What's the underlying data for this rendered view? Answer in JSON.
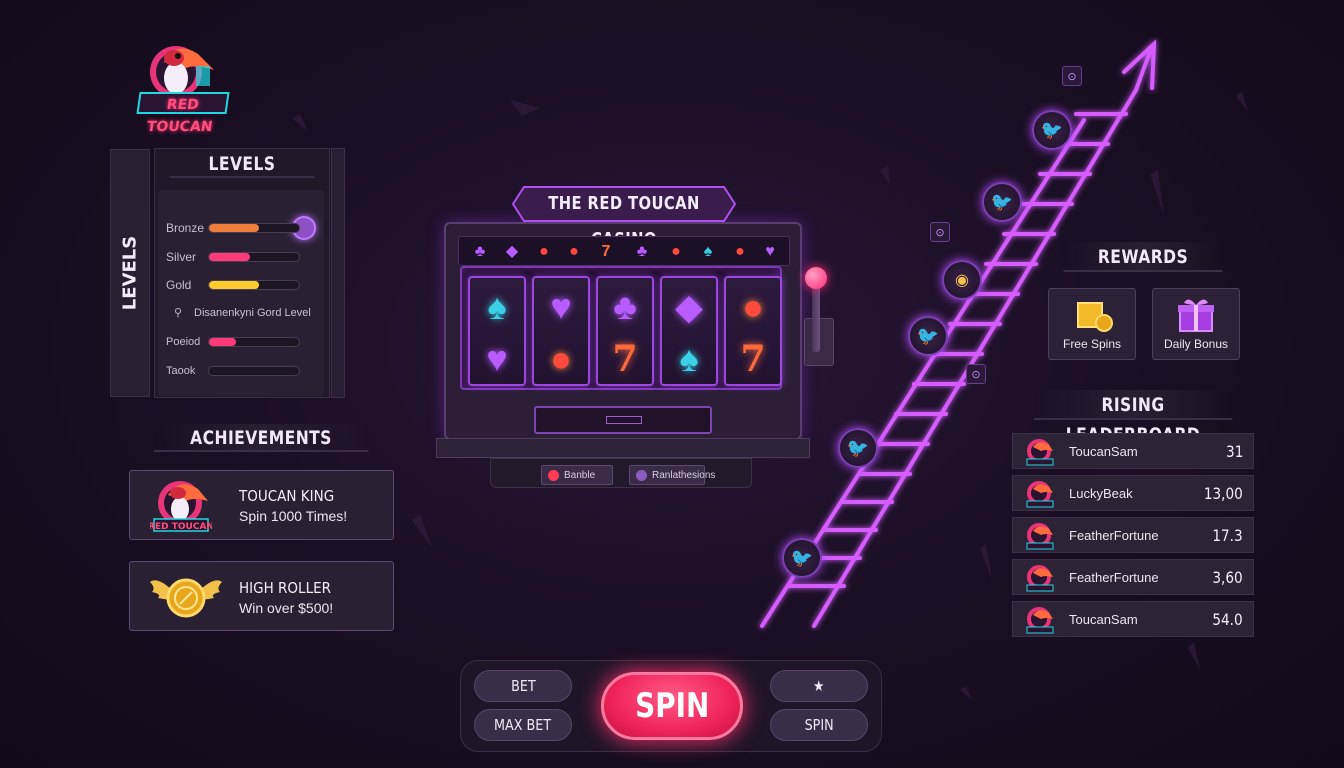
{
  "logo": {
    "text": "RED TOUCAN"
  },
  "levels": {
    "title": "LEVELS",
    "side_label": "LEVELS",
    "rows": [
      {
        "label": "Bronze",
        "progress": 0.55,
        "color": "#f07d3c"
      },
      {
        "label": "Silver",
        "progress": 0.45,
        "color": "#ff3a78"
      },
      {
        "label": "Gold",
        "progress": 0.55,
        "color": "#ffcc2e"
      },
      {
        "label": "Disanenkyni Gord Level",
        "progress": null,
        "color": "#ff3a78"
      },
      {
        "label": "Poeiod",
        "progress": 0.3,
        "color": "#ff3a78"
      },
      {
        "label": "Taook",
        "progress": 0.0,
        "color": "#ff3a78"
      }
    ]
  },
  "achievements": {
    "title": "ACHIEVEMENTS",
    "items": [
      {
        "name": "TOUCAN KING",
        "desc": "Spin 1000 Times!",
        "icon": "toucan-icon"
      },
      {
        "name": "HIGH ROLLER",
        "desc": "Win over $500!",
        "icon": "winged-coin-icon"
      }
    ]
  },
  "slot": {
    "title": "THE RED TOUCAN CASINO",
    "top_strip": [
      "♣",
      "◆",
      "●",
      "●",
      "7",
      "♣",
      "●",
      "♠",
      "●",
      "♥"
    ],
    "reels": [
      [
        "♠",
        "♥"
      ],
      [
        "♥",
        "●"
      ],
      [
        "♣",
        "7"
      ],
      [
        "◆",
        "♠"
      ],
      [
        "●",
        "7"
      ]
    ],
    "foot_buttons": [
      "Banble",
      "Ranlathesions"
    ]
  },
  "rewards": {
    "title": "REWARDS",
    "items": [
      {
        "label": "Free Spins",
        "icon": "gold-box-icon"
      },
      {
        "label": "Daily Bonus",
        "icon": "gift-box-icon"
      }
    ]
  },
  "leaderboard": {
    "title": "RISING LEADERBOARD",
    "rows": [
      {
        "name": "ToucanSam",
        "score": "31"
      },
      {
        "name": "LuckyBeak",
        "score": "13,00"
      },
      {
        "name": "FeatherFortune",
        "score": "17.3"
      },
      {
        "name": "FeatherFortune",
        "score": "3,60"
      },
      {
        "name": "ToucanSam",
        "score": "54.0"
      }
    ]
  },
  "controls": {
    "bet": "BET",
    "max_bet": "MAX BET",
    "spin_main": "SPIN",
    "star": "★",
    "spin_small": "SPIN"
  },
  "colors": {
    "accent_purple": "#b44cff",
    "accent_pink": "#ff2d6a",
    "background": "#1b0f25"
  }
}
